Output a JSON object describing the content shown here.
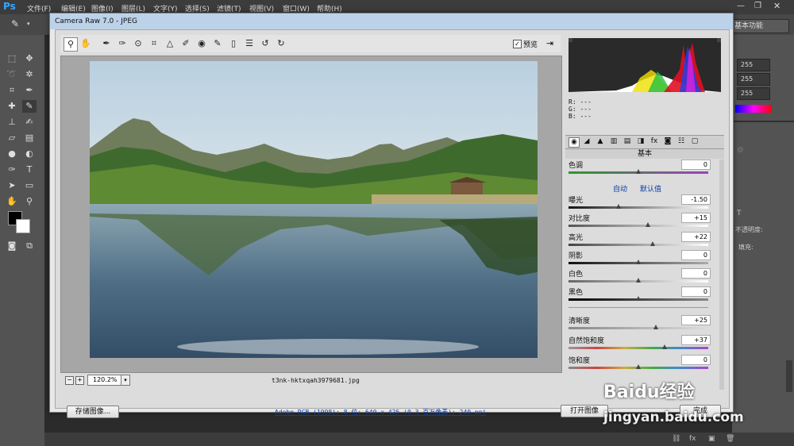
{
  "app": {
    "logo": "Ps",
    "menus": [
      "文件(F)",
      "编辑(E)",
      "图像(I)",
      "图层(L)",
      "文字(Y)",
      "选择(S)",
      "滤镜(T)",
      "视图(V)",
      "窗口(W)",
      "帮助(H)"
    ],
    "workspace": "基本功能"
  },
  "right_panel": {
    "rgb_values": [
      "255",
      "255",
      "255"
    ],
    "opacity_label": "不透明度:",
    "fill_label": "填充:"
  },
  "dialog": {
    "title": "Camera Raw 7.0 -  JPEG",
    "preview_label": "预览",
    "preview_checked": "✓",
    "zoom_level": "120.2%",
    "filename": "t3nk-hktxqah3979681.jpg",
    "rgb_readout": {
      "r": "R:  ---",
      "g": "G:  ---",
      "b": "B:  ---"
    },
    "panel_title": "基本",
    "auto_label": "自动",
    "default_label": "默认值",
    "adjustments": {
      "tint": {
        "label": "色调",
        "value": "0"
      },
      "exposure": {
        "label": "曝光",
        "value": "-1.50"
      },
      "contrast": {
        "label": "对比度",
        "value": "+15"
      },
      "highlights": {
        "label": "高光",
        "value": "+22"
      },
      "shadows": {
        "label": "阴影",
        "value": "0"
      },
      "whites": {
        "label": "白色",
        "value": "0"
      },
      "blacks": {
        "label": "黑色",
        "value": "0"
      },
      "clarity": {
        "label": "清晰度",
        "value": "+25"
      },
      "vibrance": {
        "label": "自然饱和度",
        "value": "+37"
      },
      "saturation": {
        "label": "饱和度",
        "value": "0"
      }
    },
    "save_button": "存储图像...",
    "workflow_link": "Adobe RGB (1998); 8 位; 640 x 425 (0.3 百万像素); 240 ppi",
    "open_button": "打开图像",
    "done_button": "完成"
  },
  "watermark": {
    "brand": "Baidu经验",
    "url": "jingyan.baidu.com"
  },
  "colors": {
    "ps_dark": "#3c3c3c",
    "dialog_bg": "#dcdcdc",
    "title_blue": "#bcd2e9",
    "link_blue": "#0b3ea8"
  }
}
